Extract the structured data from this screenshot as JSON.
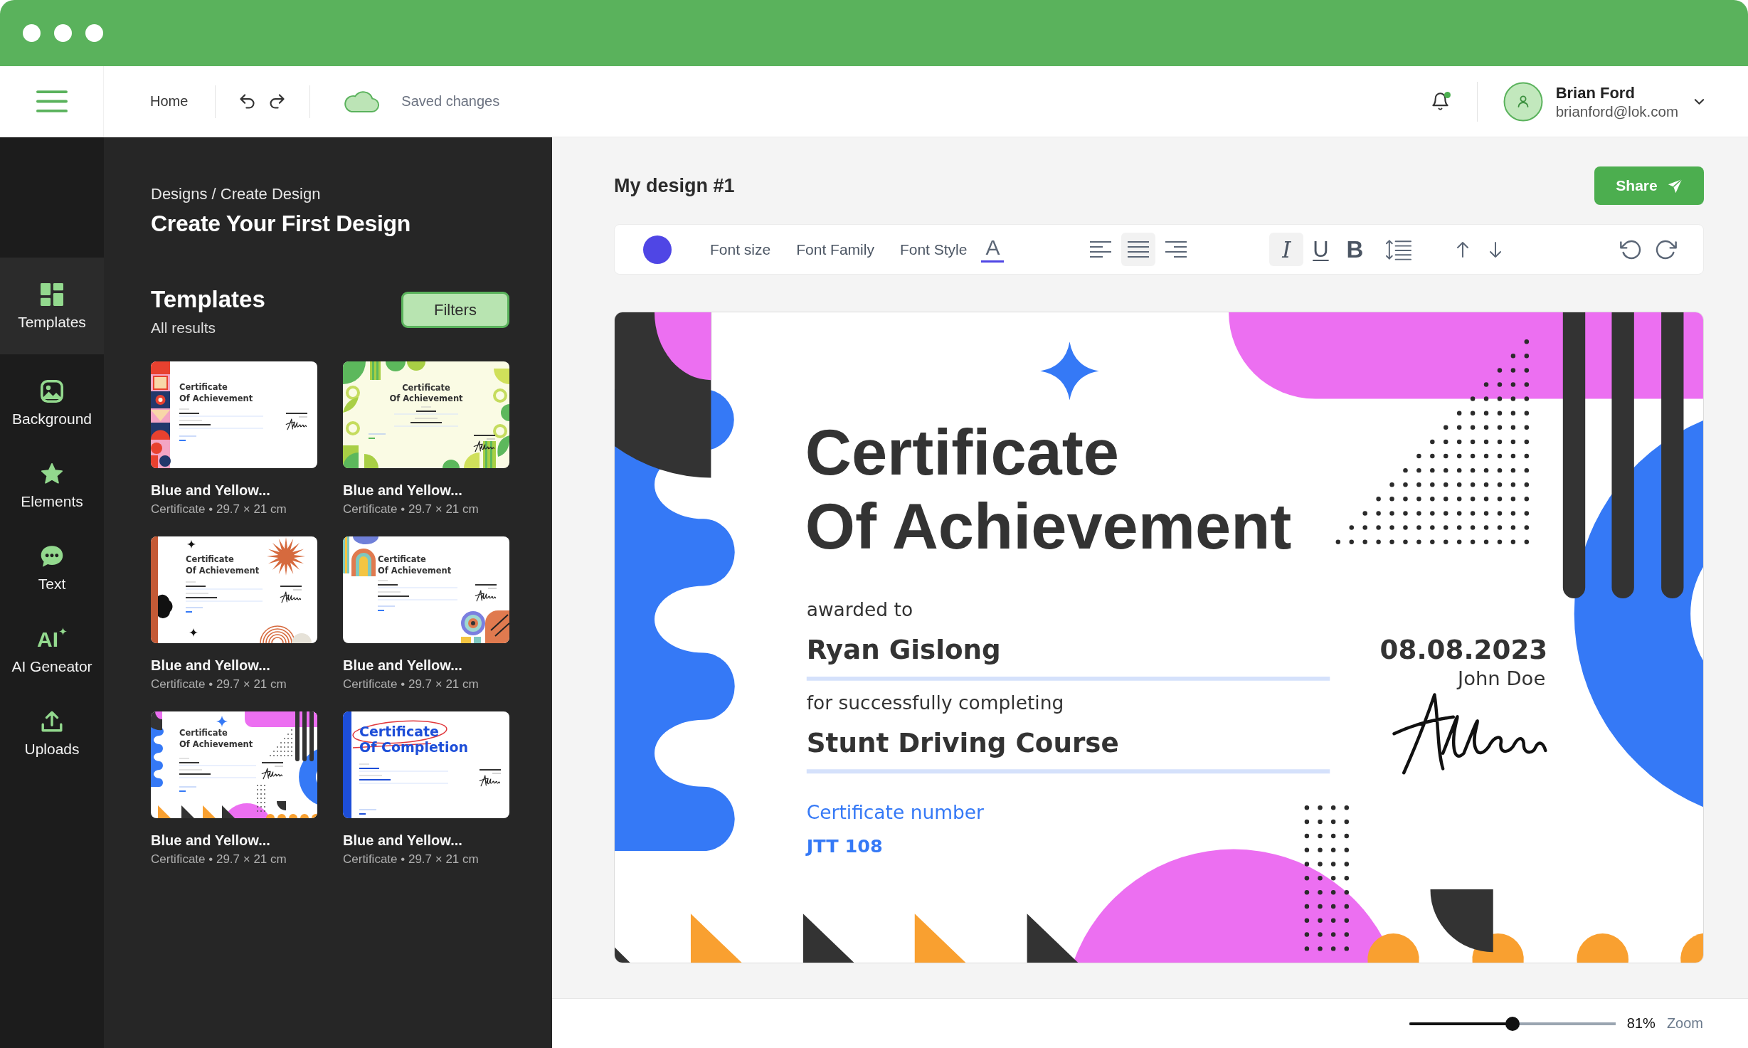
{
  "header": {
    "home_link": "Home",
    "save_status": "Saved changes",
    "notifications": {
      "unread": true
    },
    "user": {
      "name": "Brian Ford",
      "email": "brianford@lok.com"
    }
  },
  "sidebar": {
    "items": [
      {
        "label": "Templates",
        "kind": "templates",
        "selected": true
      },
      {
        "label": "Background",
        "kind": "background",
        "selected": false
      },
      {
        "label": "Elements",
        "kind": "elements",
        "selected": false
      },
      {
        "label": "Text",
        "kind": "text",
        "selected": false
      },
      {
        "label": "AI Geneator",
        "kind": "ai",
        "icon_text": "AI",
        "selected": false
      },
      {
        "label": "Uploads",
        "kind": "uploads",
        "selected": false
      }
    ]
  },
  "templates_panel": {
    "breadcrumb": "Designs / Create Design",
    "title": "Create Your First Design",
    "section_title": "Templates",
    "section_subtitle": "All results",
    "filter_button": "Filters",
    "templates": [
      {
        "kind": "geometric",
        "heading": [
          "Certificate",
          "Of Achievement"
        ],
        "name": "Blue and Yellow...",
        "meta": "Certificate • 29.7 × 21 cm"
      },
      {
        "kind": "leaf",
        "heading": [
          "Certificate",
          "Of Achievement"
        ],
        "name": "Blue and Yellow...",
        "meta": "Certificate • 29.7 × 21 cm"
      },
      {
        "kind": "sun",
        "heading": [
          "Certificate",
          "Of Achievement"
        ],
        "name": "Blue and Yellow...",
        "meta": "Certificate • 29.7 × 21 cm"
      },
      {
        "kind": "rainbow",
        "heading": [
          "Certificate",
          "Of Achievement"
        ],
        "name": "Blue and Yellow...",
        "meta": "Certificate • 29.7 × 21 cm"
      },
      {
        "kind": "memphis",
        "heading": [
          "Certificate",
          "Of Achievement"
        ],
        "name": "Blue and Yellow...",
        "meta": "Certificate • 29.7 × 21 cm"
      },
      {
        "kind": "completion",
        "heading": [
          "Certificate",
          "Of Completion"
        ],
        "name": "Blue and Yellow...",
        "meta": "Certificate • 29.7 × 21 cm"
      }
    ]
  },
  "editor": {
    "title": "My design #1",
    "share_button": "Share",
    "toolbar": {
      "color": "#4f46e5",
      "font_menus": [
        {
          "label": "Font size"
        },
        {
          "label": "Font Family"
        },
        {
          "label": "Font Style"
        }
      ],
      "text_color_glyph": "A",
      "align": [
        {
          "kind": "left",
          "selected": false
        },
        {
          "kind": "center",
          "selected": true
        },
        {
          "kind": "right",
          "selected": false
        }
      ],
      "format": [
        {
          "kind": "italic",
          "glyph": "I",
          "selected": true
        },
        {
          "kind": "underline",
          "glyph": "U",
          "selected": false
        },
        {
          "kind": "bold",
          "glyph": "B",
          "selected": false
        }
      ]
    },
    "certificate": {
      "title": [
        "Certificate",
        "Of Achievement"
      ],
      "awarded_label": "awarded to",
      "recipient": "Ryan Gislong",
      "course_label": "for successfully completing",
      "course": "Stunt Driving Course",
      "number_label": "Certificate number",
      "number": "JTT 108",
      "date": "08.08.2023",
      "signer": "John Doe"
    },
    "zoom": {
      "level": 0.5,
      "reading": "81%",
      "label": "Zoom"
    }
  }
}
